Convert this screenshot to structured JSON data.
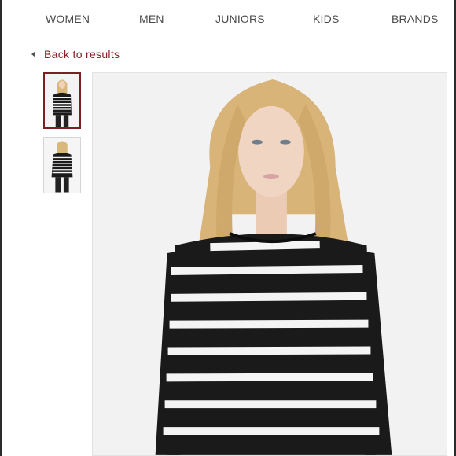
{
  "nav": {
    "items": [
      "WOMEN",
      "MEN",
      "JUNIORS",
      "KIDS",
      "BRANDS"
    ]
  },
  "back_link": {
    "label": "Back to results",
    "icon": "triangle-left-icon"
  },
  "thumbnails": [
    {
      "name": "thumbnail-front-view",
      "selected": true
    },
    {
      "name": "thumbnail-back-view",
      "selected": false
    }
  ],
  "main_image": {
    "name": "product-main-image"
  },
  "colors": {
    "accent": "#8a1c24",
    "thumb_selected_border": "#7a1f22",
    "nav_text": "#4a4a4a",
    "image_background": "#f2f2f2"
  }
}
